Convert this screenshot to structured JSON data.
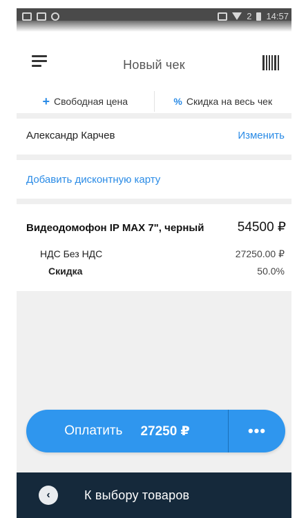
{
  "status_bar": {
    "time": "14:57",
    "signal_text": "2"
  },
  "header": {
    "title": "Новый чек"
  },
  "actions": {
    "free_price": {
      "icon": "+",
      "label": "Свободная цена"
    },
    "discount_all": {
      "icon": "%",
      "label": "Скидка на весь чек"
    }
  },
  "customer": {
    "name": "Александр Карчев",
    "change_label": "Изменить"
  },
  "discount_card": {
    "label": "Добавить дисконтную карту"
  },
  "item": {
    "name": "Видеодомофон IP MAX 7\", черный",
    "price": "54500 ₽",
    "vat_label": "НДС Без НДС",
    "vat_value": "27250.00 ₽",
    "discount_label": "Скидка",
    "discount_value": "50.0%"
  },
  "pay_button": {
    "label": "Оплатить",
    "amount": "27250 ₽",
    "more": "•••"
  },
  "bottom": {
    "label": "К выбору товаров",
    "back_icon": "‹"
  },
  "colors": {
    "accent": "#2f96ee",
    "link": "#2a8be6",
    "bottom_bar": "#15293b",
    "background_grey": "#f0f0f0"
  }
}
